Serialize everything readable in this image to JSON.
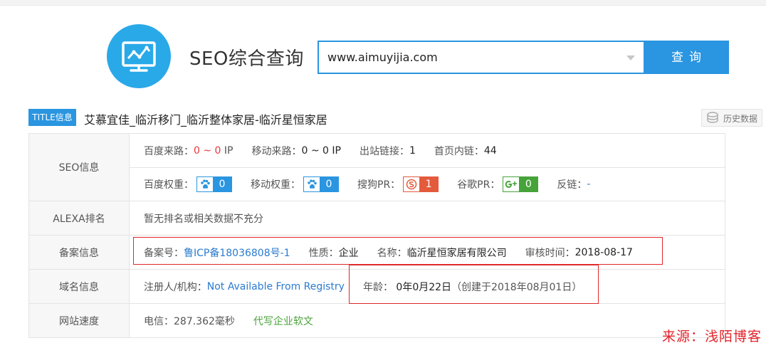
{
  "header": {
    "app_title": "SEO综合查询",
    "search_value": "www.aimuyijia.com",
    "search_button": "查询"
  },
  "title_row": {
    "badge": "TITLE信息",
    "text": "艾慕宜佳_临沂移门_临沂整体家居-临沂星恒家居",
    "history_label": "历史数据"
  },
  "seo": {
    "label": "SEO信息",
    "baidu_traffic_label": "百度来路：",
    "baidu_traffic_value": "0 ~ 0",
    "baidu_traffic_unit": "IP",
    "mobile_traffic_label": "移动来路：",
    "mobile_traffic_value": "0 ~ 0 IP",
    "outbound_label": "出站链接：",
    "outbound_value": "1",
    "inbound_label": "首页内链：",
    "inbound_value": "44",
    "baidu_weight_label": "百度权重：",
    "baidu_weight_value": "0",
    "mobile_weight_label": "移动权重：",
    "mobile_weight_value": "0",
    "sogou_pr_label": "搜狗PR：",
    "sogou_pr_value": "1",
    "google_pr_label": "谷歌PR：",
    "google_pr_value": "0",
    "backlinks_label": "反链：",
    "backlinks_value": "-"
  },
  "alexa": {
    "label": "ALEXA排名",
    "text": "暂无排名或相关数据不充分"
  },
  "icp": {
    "label": "备案信息",
    "number_label": "备案号：",
    "number_value": "鲁ICP备18036808号-1",
    "nature_label": "性质：",
    "nature_value": "企业",
    "name_label": "名称：",
    "name_value": "临沂星恒家居有限公司",
    "audit_label": "审核时间：",
    "audit_value": "2018-08-17"
  },
  "domain": {
    "label": "域名信息",
    "registrant_label": "注册人/机构：",
    "registrant_value": "Not Available From Registry",
    "age_label": "年龄：",
    "age_value": "0年0月22日",
    "created_text": "（创建于2018年08月01日）"
  },
  "speed": {
    "label": "网站速度",
    "telecom_label": "电信：",
    "telecom_value": "287.362毫秒",
    "promo_link": "代写企业软文"
  },
  "watermark": "来源：浅陌博客",
  "colors": {
    "accent": "#2a95e0",
    "logo": "#29a9e8",
    "red": "#e4393c",
    "sogou": "#e45a3c",
    "google": "#46a33a",
    "highlight_box": "#e0282b"
  },
  "icons": [
    "monitor-chart-icon",
    "dropdown-caret-icon",
    "history-icon",
    "baidu-paw-icon",
    "sogou-icon",
    "google-plus-icon"
  ]
}
